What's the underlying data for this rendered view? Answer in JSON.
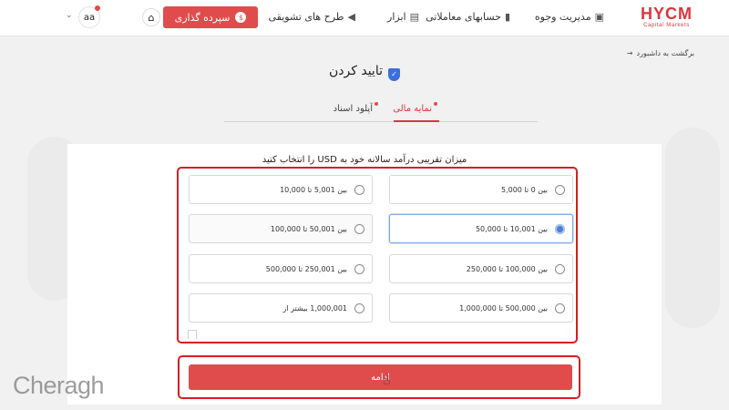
{
  "logo": {
    "brand": "HYCM",
    "sub": "Capital Markets"
  },
  "nav": {
    "items": [
      {
        "label": "مدیریت وجوه",
        "icon": "wallet-icon"
      },
      {
        "label": "حسابهای معاملاتی",
        "icon": "bar-chart-icon"
      },
      {
        "label": "ابزار",
        "icon": "tools-icon"
      },
      {
        "label": "طرح های تشویقی",
        "icon": "megaphone-icon"
      }
    ],
    "deposit_label": "سپرده گذاری",
    "avatar_initials": "aa"
  },
  "back_link": "برگشت به داشبورد",
  "page_title": "تایید کردن",
  "tabs": [
    {
      "label": "نمایه مالی",
      "active": true
    },
    {
      "label": "آپلود اسناد",
      "active": false
    }
  ],
  "question": "میزان تقریبی درآمد سالانه خود به USD را انتخاب کنید",
  "options": [
    {
      "label": "بین 0 تا 5,000",
      "selected": false
    },
    {
      "label": "بین 5,001 تا 10,000",
      "selected": false
    },
    {
      "label": "بین 10,001 تا 50,000",
      "selected": true
    },
    {
      "label": "بین 50,001 تا 100,000",
      "selected": false
    },
    {
      "label": "بین 100,000 تا 250,000",
      "selected": false
    },
    {
      "label": "بین 250,001 تا 500,000",
      "selected": false
    },
    {
      "label": "بین 500,000 تا 1,000,000",
      "selected": false
    },
    {
      "label": "1,000,001 بیشتر از",
      "selected": false
    }
  ],
  "continue_label": "ادامه",
  "watermark": "Cheragh",
  "colors": {
    "accent": "#e04c4c",
    "highlight": "#d41f25",
    "selected_radio": "#4a7fd8"
  }
}
